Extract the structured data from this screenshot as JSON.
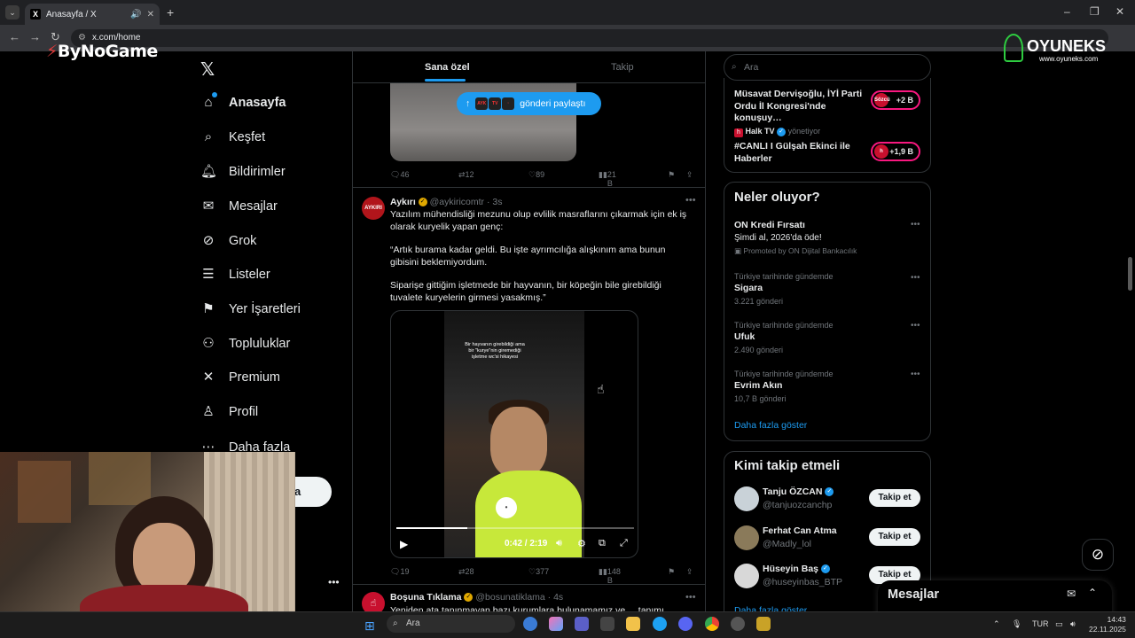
{
  "browser": {
    "tab_title": "Anasayfa / X",
    "url": "x.com/home",
    "tab_favicon": "X"
  },
  "overlays": {
    "bynogame": "ByNoGame",
    "oyuneks_name": "OYUNEKS",
    "oyuneks_site": "www.oyuneks.com"
  },
  "nav": {
    "items": [
      {
        "label": "Anasayfa",
        "icon": "home-icon"
      },
      {
        "label": "Keşfet",
        "icon": "search-icon"
      },
      {
        "label": "Bildirimler",
        "icon": "bell-icon"
      },
      {
        "label": "Mesajlar",
        "icon": "mail-icon"
      },
      {
        "label": "Grok",
        "icon": "grok-icon"
      },
      {
        "label": "Listeler",
        "icon": "list-icon"
      },
      {
        "label": "Yer İşaretleri",
        "icon": "bookmark-icon"
      },
      {
        "label": "Topluluklar",
        "icon": "community-icon"
      },
      {
        "label": "Premium",
        "icon": "x-icon"
      },
      {
        "label": "Profil",
        "icon": "profile-icon"
      },
      {
        "label": "Daha fazla",
        "icon": "more-icon"
      }
    ],
    "post_label": "a"
  },
  "feed": {
    "tabs": [
      "Sana özel",
      "Takip"
    ],
    "new_posts_label": "gönderi paylaştı",
    "tweet1_actions": {
      "replies": "46",
      "retweets": "12",
      "likes": "89",
      "views": "21 B"
    },
    "tweet2": {
      "name": "Aykırı",
      "handle": "@aykiricomtr",
      "time": "· 3s",
      "avatar_text": "AYKIRI",
      "lines": [
        "Yazılım mühendisliği mezunu olup evlilik masraflarını çıkarmak için ek iş olarak kuryelik yapan genç:",
        "“Artık burama kadar geldi. Bu işte ayrımcılığa alışkınım ama bunun gibisini beklemiyordum.",
        "Siparişe gittiğim işletmede bir hayvanın, bir köpeğin bile girebildiği tuvalete kuryelerin girmesi yasakmış.”"
      ],
      "video_caption": "Bir hayvanın girebildiği ama bir \"kurye\"nin giremediği işletme wc'si hikayesi",
      "video_time": "0:42 / 2:19",
      "video_progress": 0.3,
      "vest_logo": "trendyol",
      "actions": {
        "replies": "19",
        "retweets": "28",
        "likes": "377",
        "views": "148 B"
      }
    },
    "tweet3": {
      "name": "Boşuna Tıklama",
      "handle": "@bosunatiklama",
      "time": "· 4s",
      "avatar_text": "☝",
      "partial_text": "Yeniden ata tanınmayan bazı kurumlara bulunamamız ve ... tanımı"
    }
  },
  "right": {
    "search_placeholder": "Ara",
    "live": [
      {
        "title": "Müsavat Dervişoğlu, İYİ Parti Ordu İl Kongresi'nde konuşuy…",
        "badge": "+2 B",
        "badge_logo": "Sözcü"
      },
      {
        "source": "Halk TV",
        "source_meta": "yönetiyor",
        "title": "#CANLI I Gülşah Ekinci ile Haberler",
        "badge": "+1,9 B",
        "badge_logo": "h"
      }
    ],
    "trends_header": "Neler oluyor?",
    "promo": {
      "name": "ON Kredi Fırsatı",
      "sub": "Şimdi al, 2026'da öde!",
      "promoted": "Promoted by ON Dijital Bankacılık"
    },
    "trends": [
      {
        "meta": "Türkiye tarihinde gündemde",
        "name": "Sigara",
        "count": "3.221 gönderi"
      },
      {
        "meta": "Türkiye tarihinde gündemde",
        "name": "Ufuk",
        "count": "2.490 gönderi"
      },
      {
        "meta": "Türkiye tarihinde gündemde",
        "name": "Evrim Akın",
        "count": "10,7 B gönderi"
      }
    ],
    "show_more": "Daha fazla göster",
    "who_header": "Kimi takip etmeli",
    "follow_label": "Takip et",
    "who": [
      {
        "name": "Tanju ÖZCAN",
        "handle": "@tanjuozcanchp"
      },
      {
        "name": "Ferhat Can Atma",
        "handle": "@Madly_lol"
      },
      {
        "name": "Hüseyin Baş",
        "handle": "@huseyinbas_BTP"
      }
    ],
    "who_show_more": "Daha fazla göster"
  },
  "messages_drawer": {
    "title": "Mesajlar"
  },
  "taskbar": {
    "search": "Ara",
    "lang": "TUR",
    "time": "14:43",
    "date": "22.11.2025"
  }
}
